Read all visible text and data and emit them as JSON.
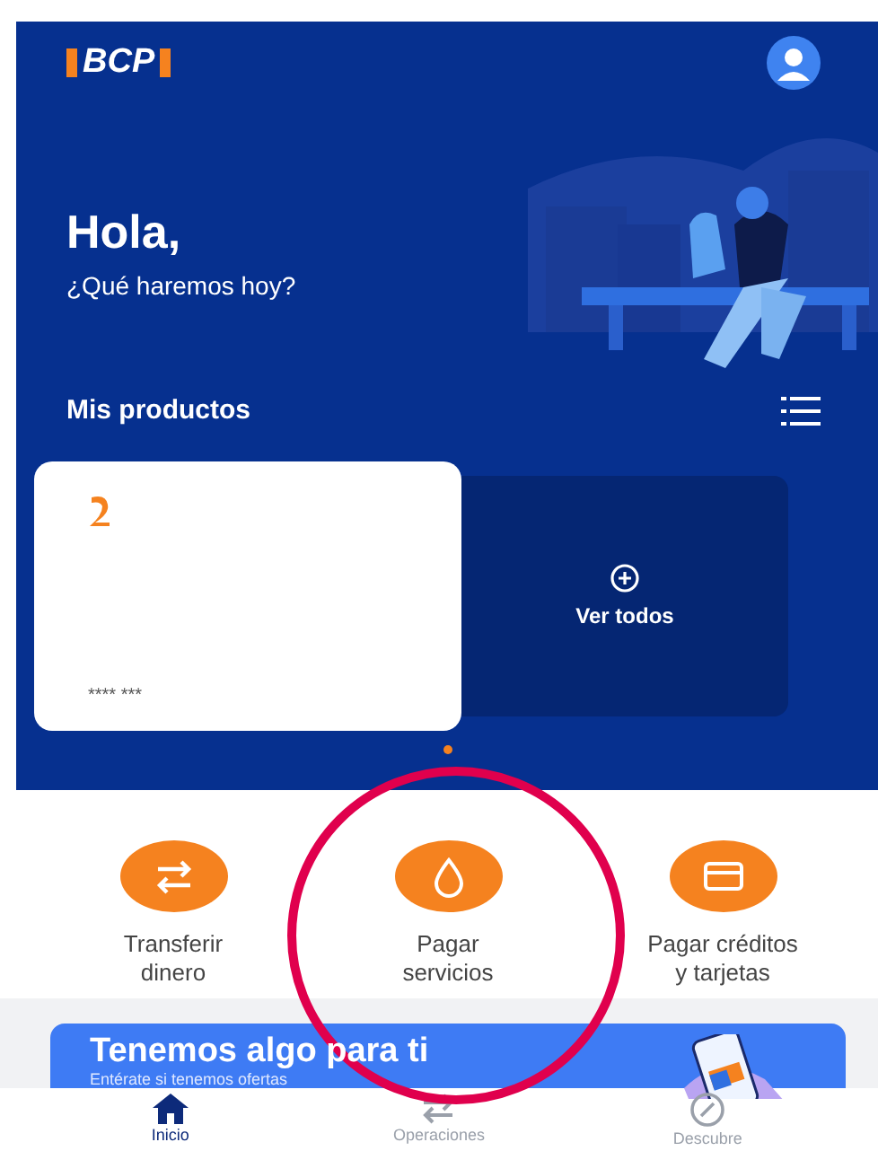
{
  "header": {
    "logo": "BCP"
  },
  "greeting": {
    "title": "Hola,",
    "subtitle": "¿Qué haremos hoy?"
  },
  "products": {
    "title": "Mis productos",
    "card": {
      "number": "**** ***"
    },
    "see_all": "Ver todos",
    "pager": [
      {
        "selected": true
      }
    ]
  },
  "actions": [
    {
      "kind": "transfer",
      "label": "Transferir\ndinero"
    },
    {
      "kind": "drop",
      "label": "Pagar\nservicios"
    },
    {
      "kind": "card",
      "label": "Pagar créditos\ny tarjetas"
    }
  ],
  "promo": {
    "title": "Tenemos algo para ti",
    "subtitle": "Entérate si tenemos ofertas"
  },
  "nav": [
    {
      "kind": "home",
      "label": "Inicio",
      "selected": true
    },
    {
      "kind": "ops",
      "label": "Operaciones",
      "selected": false
    },
    {
      "kind": "compass",
      "label": "Descubre",
      "selected": false
    }
  ]
}
